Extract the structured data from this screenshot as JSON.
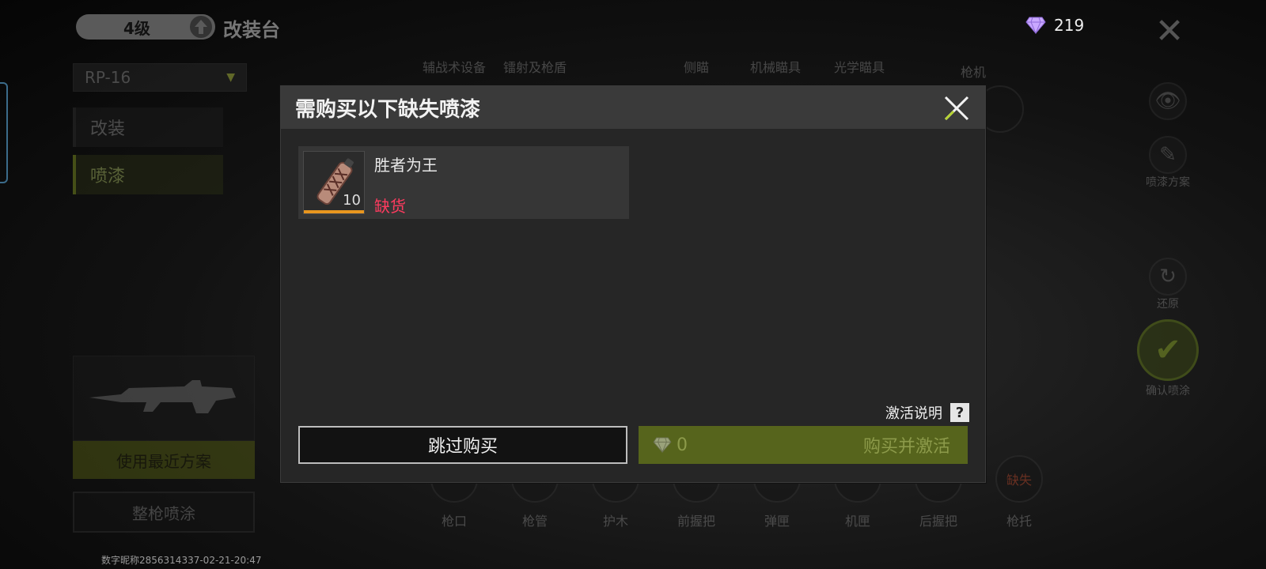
{
  "header": {
    "level": "4级",
    "title": "改装台",
    "currency_amount": "219"
  },
  "weapon_select": {
    "value": "RP-16"
  },
  "side_tabs": [
    {
      "label": "改装"
    },
    {
      "label": "喷漆"
    }
  ],
  "top_slots": [
    {
      "label": "辅战术设备"
    },
    {
      "label": "镭射及枪盾"
    },
    {
      "label": "侧瞄"
    },
    {
      "label": "机械瞄具"
    },
    {
      "label": "光学瞄具"
    },
    {
      "label": "枪机"
    }
  ],
  "bottom_slots": [
    {
      "label": "枪口"
    },
    {
      "label": "枪管"
    },
    {
      "label": "护木"
    },
    {
      "label": "前握把"
    },
    {
      "label": "弹匣"
    },
    {
      "label": "机匣"
    },
    {
      "label": "后握把"
    },
    {
      "label": "枪托",
      "badge": "缺失"
    }
  ],
  "right_panel": {
    "paint_scheme_label": "喷漆方案",
    "restore_label": "还原",
    "confirm_label": "确认喷涂"
  },
  "left_panel": {
    "recent_scheme_label": "使用最近方案",
    "whole_gun_label": "整枪喷涂"
  },
  "watermark": "数字昵称2856314337-02-21-20:47",
  "modal": {
    "title": "需购买以下缺失喷漆",
    "item": {
      "name": "胜者为王",
      "quantity": "10",
      "status": "缺货",
      "status_color": "#ff3b5f"
    },
    "help_label": "激活说明",
    "help_icon": "?",
    "skip_label": "跳过购买",
    "buy_price": "0",
    "buy_label": "购买并激活"
  },
  "colors": {
    "accent": "#8aa024",
    "buy_button": "#56641c",
    "out_of_stock": "#ff3b5f"
  }
}
